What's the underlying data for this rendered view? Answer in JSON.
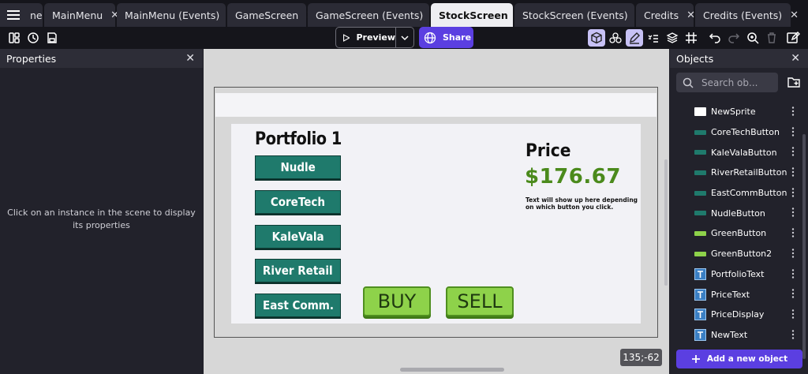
{
  "tabs": [
    {
      "label": "ne",
      "active": false
    },
    {
      "label": "MainMenu",
      "active": false
    },
    {
      "label": "MainMenu (Events)",
      "active": false
    },
    {
      "label": "GameScreen",
      "active": false
    },
    {
      "label": "GameScreen (Events)",
      "active": false
    },
    {
      "label": "StockScreen",
      "active": true
    },
    {
      "label": "StockScreen (Events)",
      "active": false
    },
    {
      "label": "Credits",
      "active": false
    },
    {
      "label": "Credits (Events)",
      "active": false
    }
  ],
  "toolbar": {
    "preview_label": "Preview",
    "share_label": "Share"
  },
  "properties": {
    "title": "Properties",
    "empty_message": "Click on an instance in the scene to display its properties"
  },
  "scene": {
    "portfolio_title": "Portfolio 1",
    "stock_buttons": [
      "Nudle",
      "CoreTech",
      "KaleVala",
      "River Retail",
      "East Comm."
    ],
    "price_title": "Price",
    "price_value": "$176.67",
    "price_description": "Text will show up here depending on which button you click.",
    "buy_label": "BUY",
    "sell_label": "SELL",
    "coordinates": "135;-62"
  },
  "objects": {
    "title": "Objects",
    "search_placeholder": "Search ob...",
    "items": [
      {
        "name": "NewSprite",
        "kind": "sprite-white"
      },
      {
        "name": "CoreTechButton",
        "kind": "teal"
      },
      {
        "name": "KaleValaButton",
        "kind": "teal"
      },
      {
        "name": "RiverRetailButton",
        "kind": "teal"
      },
      {
        "name": "EastCommButton",
        "kind": "teal"
      },
      {
        "name": "NudleButton",
        "kind": "teal"
      },
      {
        "name": "GreenButton",
        "kind": "green"
      },
      {
        "name": "GreenButton2",
        "kind": "green"
      },
      {
        "name": "PortfolioText",
        "kind": "text"
      },
      {
        "name": "PriceText",
        "kind": "text"
      },
      {
        "name": "PriceDisplay",
        "kind": "text"
      },
      {
        "name": "NewText",
        "kind": "text"
      }
    ],
    "add_label": "Add a new object"
  },
  "colors": {
    "accent": "#5b3fe1",
    "teal": "#1f7a6c",
    "green": "#8ed24a",
    "price_green": "#4b8a1c"
  }
}
